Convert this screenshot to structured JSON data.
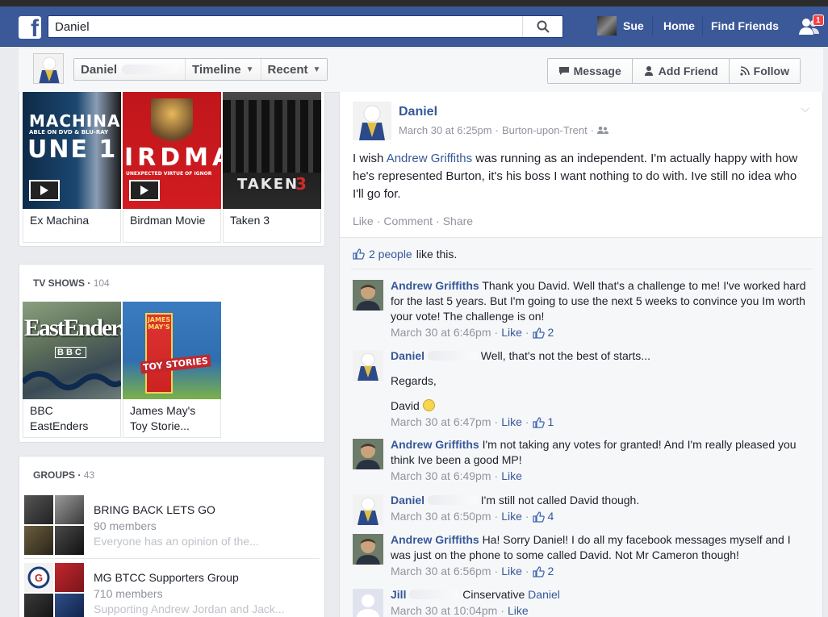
{
  "topbar": {
    "search_value": "Daniel",
    "user_name": "Sue",
    "home_label": "Home",
    "find_friends_label": "Find Friends",
    "friend_requests_count": "1"
  },
  "subheader": {
    "breadcrumbs": [
      "Daniel",
      "Timeline",
      "Recent"
    ],
    "buttons": {
      "message": "Message",
      "add_friend": "Add Friend",
      "follow": "Follow"
    }
  },
  "movies": {
    "items": [
      {
        "caption": "Ex Machina",
        "poster_lines": [
          "MACHINA",
          "ABLE ON DVD & BLU-RAY",
          "UNE 1"
        ]
      },
      {
        "caption": "Birdman Movie",
        "poster_lines": [
          "IRDMA",
          "UNEXPECTED VIRTUE OF IGNOR"
        ]
      },
      {
        "caption": "Taken 3",
        "poster_lines": [
          "TAKEN"
        ]
      }
    ]
  },
  "tv_shows": {
    "title": "TV SHOWS",
    "count": "104",
    "items": [
      {
        "caption_1": "BBC",
        "caption_2": "EastEnders",
        "poster_lines": [
          "EastEnders",
          "BBC"
        ]
      },
      {
        "caption_1": "James May's",
        "caption_2": "Toy Storie...",
        "poster_lines": [
          "JAMES MAY'S",
          "TOY STORIES"
        ]
      }
    ]
  },
  "groups": {
    "title": "GROUPS",
    "count": "43",
    "items": [
      {
        "name": "BRING BACK LETS GO",
        "members": "90 members",
        "desc": "Everyone has an opinion of the..."
      },
      {
        "name": "MG BTCC Supporters Group",
        "members": "710 members",
        "desc": "Supporting Andrew Jordan and Jack..."
      }
    ]
  },
  "post": {
    "author": "Daniel",
    "date": "March 30 at 6:25pm",
    "location": "Burton-upon-Trent",
    "text_before_link": "I wish ",
    "mention": "Andrew Griffiths",
    "text_after_link": " was running as an independent. I'm actually happy with how he's represented Burton, it's his boss I want nothing to do with. Ive still no idea who I'll go for.",
    "actions": [
      "Like",
      "Comment",
      "Share"
    ],
    "likes_link": "2 people",
    "likes_suffix": "like this."
  },
  "comments": [
    {
      "author": "Andrew Griffiths",
      "text": "Thank you David. Well that's a challenge to me! I've worked hard for the last 5 years. But I'm going to use the next 5 weeks to convince you Im worth your vote! The challenge is on!",
      "date": "March 30 at 6:46pm",
      "like": "Like",
      "likes": "2"
    },
    {
      "author": "Daniel",
      "text": "Well, that's not the best of starts...",
      "line2": "Regards,",
      "line3": "David",
      "date": "March 30 at 6:47pm",
      "like": "Like",
      "likes": "1"
    },
    {
      "author": "Andrew Griffiths",
      "text": "I'm not taking any votes for granted! And I'm really pleased you think Ive been a good MP!",
      "date": "March 30 at 6:49pm",
      "like": "Like"
    },
    {
      "author": "Daniel",
      "text": "I'm still not called David though.",
      "date": "March 30 at 6:50pm",
      "like": "Like",
      "likes": "4"
    },
    {
      "author": "Andrew Griffiths",
      "text": "Ha! Sorry Daniel! I do all my facebook messages myself and I was just on the phone to some called David. Not Mr Cameron though!",
      "date": "March 30 at 6:56pm",
      "like": "Like",
      "likes": "2"
    },
    {
      "author": "Jill",
      "text": "Cinservative",
      "mention": "Daniel",
      "date": "March 30 at 10:04pm",
      "like": "Like"
    }
  ],
  "colors": {
    "brand": "#3b5998",
    "link": "#365899",
    "badge": "#fa3e3e"
  }
}
